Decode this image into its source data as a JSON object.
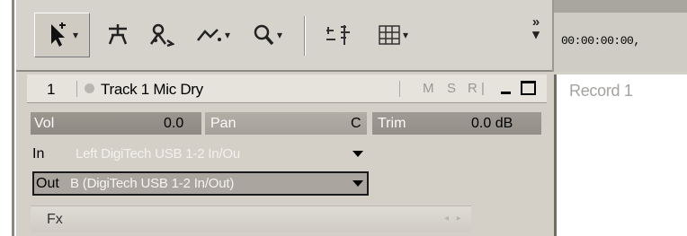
{
  "toolbar": {
    "tools": [
      {
        "icon": "pointer-tool-icon",
        "has_dropdown": true
      },
      {
        "icon": "scissors-tool-icon",
        "has_dropdown": false
      },
      {
        "icon": "envelope-tool-icon",
        "has_dropdown": false
      },
      {
        "icon": "draw-tool-icon",
        "has_dropdown": true
      },
      {
        "icon": "zoom-tool-icon",
        "has_dropdown": true
      },
      {
        "icon": "snap-tool-icon",
        "has_dropdown": false
      },
      {
        "icon": "grid-tool-icon",
        "has_dropdown": true
      }
    ],
    "overflow_icon": "chevron-more-icon"
  },
  "ruler": {
    "timecode": "00:00:00:00,"
  },
  "track": {
    "number": "1",
    "name": "Track 1 Mic Dry",
    "buttons": {
      "mute": "M",
      "solo": "S",
      "record": "R"
    },
    "vol_label": "Vol",
    "vol_value": "0.0",
    "pan_label": "Pan",
    "pan_value": "C",
    "trim_label": "Trim",
    "trim_value": "0.0 dB",
    "in_label": "In",
    "in_value": "Left DigiTech USB 1-2 In/Ou",
    "out_label": "Out",
    "out_value": "B (DigiTech USB 1-2 In/Out)",
    "fx_label": "Fx"
  },
  "record_area": {
    "label": "Record 1"
  }
}
